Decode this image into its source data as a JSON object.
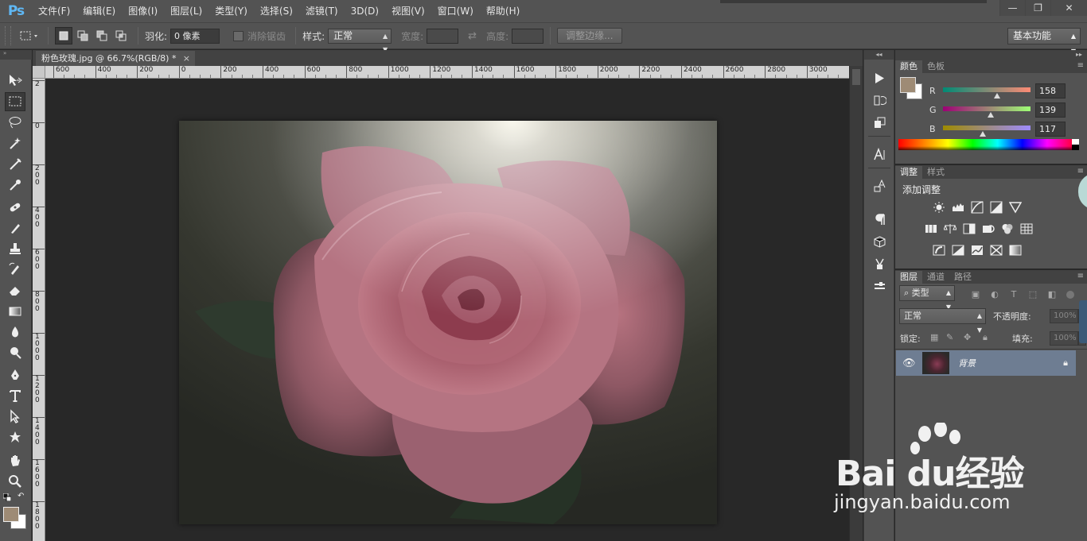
{
  "app": {
    "logo": "Ps"
  },
  "menu": [
    "文件(F)",
    "编辑(E)",
    "图像(I)",
    "图层(L)",
    "类型(Y)",
    "选择(S)",
    "滤镜(T)",
    "3D(D)",
    "视图(V)",
    "窗口(W)",
    "帮助(H)"
  ],
  "window_controls": {
    "minimize": "—",
    "restore": "❐",
    "close": "✕"
  },
  "options": {
    "feather_label": "羽化:",
    "feather_value": "0 像素",
    "antialias_label": "消除锯齿",
    "style_label": "样式:",
    "style_value": "正常",
    "width_label": "宽度:",
    "height_label": "高度:",
    "refine_edge": "调整边缘...",
    "workspace": "基本功能"
  },
  "document": {
    "tab_title": "粉色玫瑰.jpg @ 66.7%(RGB/8) *",
    "close": "×"
  },
  "rulers": {
    "h_labels": [
      "600",
      "400",
      "200",
      "0",
      "200",
      "400",
      "600",
      "800",
      "1000",
      "1200",
      "1400",
      "1600",
      "1800",
      "2000",
      "2200",
      "2400",
      "2600",
      "2800",
      "3000"
    ],
    "v_labels": [
      "2",
      "0",
      "2 0 0",
      "4 0 0",
      "6 0 0",
      "8 0 0",
      "1 0 0 0",
      "1 2 0 0",
      "1 4 0 0",
      "1 6 0 0",
      "1 8 0 0"
    ]
  },
  "color_panel": {
    "tabs": [
      "颜色",
      "色板"
    ],
    "r_label": "R",
    "g_label": "G",
    "b_label": "B",
    "r": "158",
    "g": "139",
    "b": "117",
    "foreground": "#9e8b75",
    "background": "#ffffff"
  },
  "adjustments_panel": {
    "tabs": [
      "调整",
      "样式"
    ],
    "title": "添加调整"
  },
  "layers_panel": {
    "tabs": [
      "图层",
      "通道",
      "路径"
    ],
    "filter": "类型",
    "blend_mode": "正常",
    "opacity_label": "不透明度:",
    "opacity_value": "100%",
    "lock_label": "锁定:",
    "fill_label": "填充:",
    "fill_value": "100%",
    "layers": [
      {
        "name": "背景",
        "visible": true,
        "locked": true
      }
    ]
  },
  "watermark": {
    "brand": "Bai du经验",
    "url": "jingyan.baidu.com"
  },
  "colors": {
    "ui_dark": "#535353",
    "ui_darker": "#424242",
    "canvas_bg": "#282828",
    "layer_selected": "#6e7d92",
    "ps_blue": "#5fb8f5"
  }
}
